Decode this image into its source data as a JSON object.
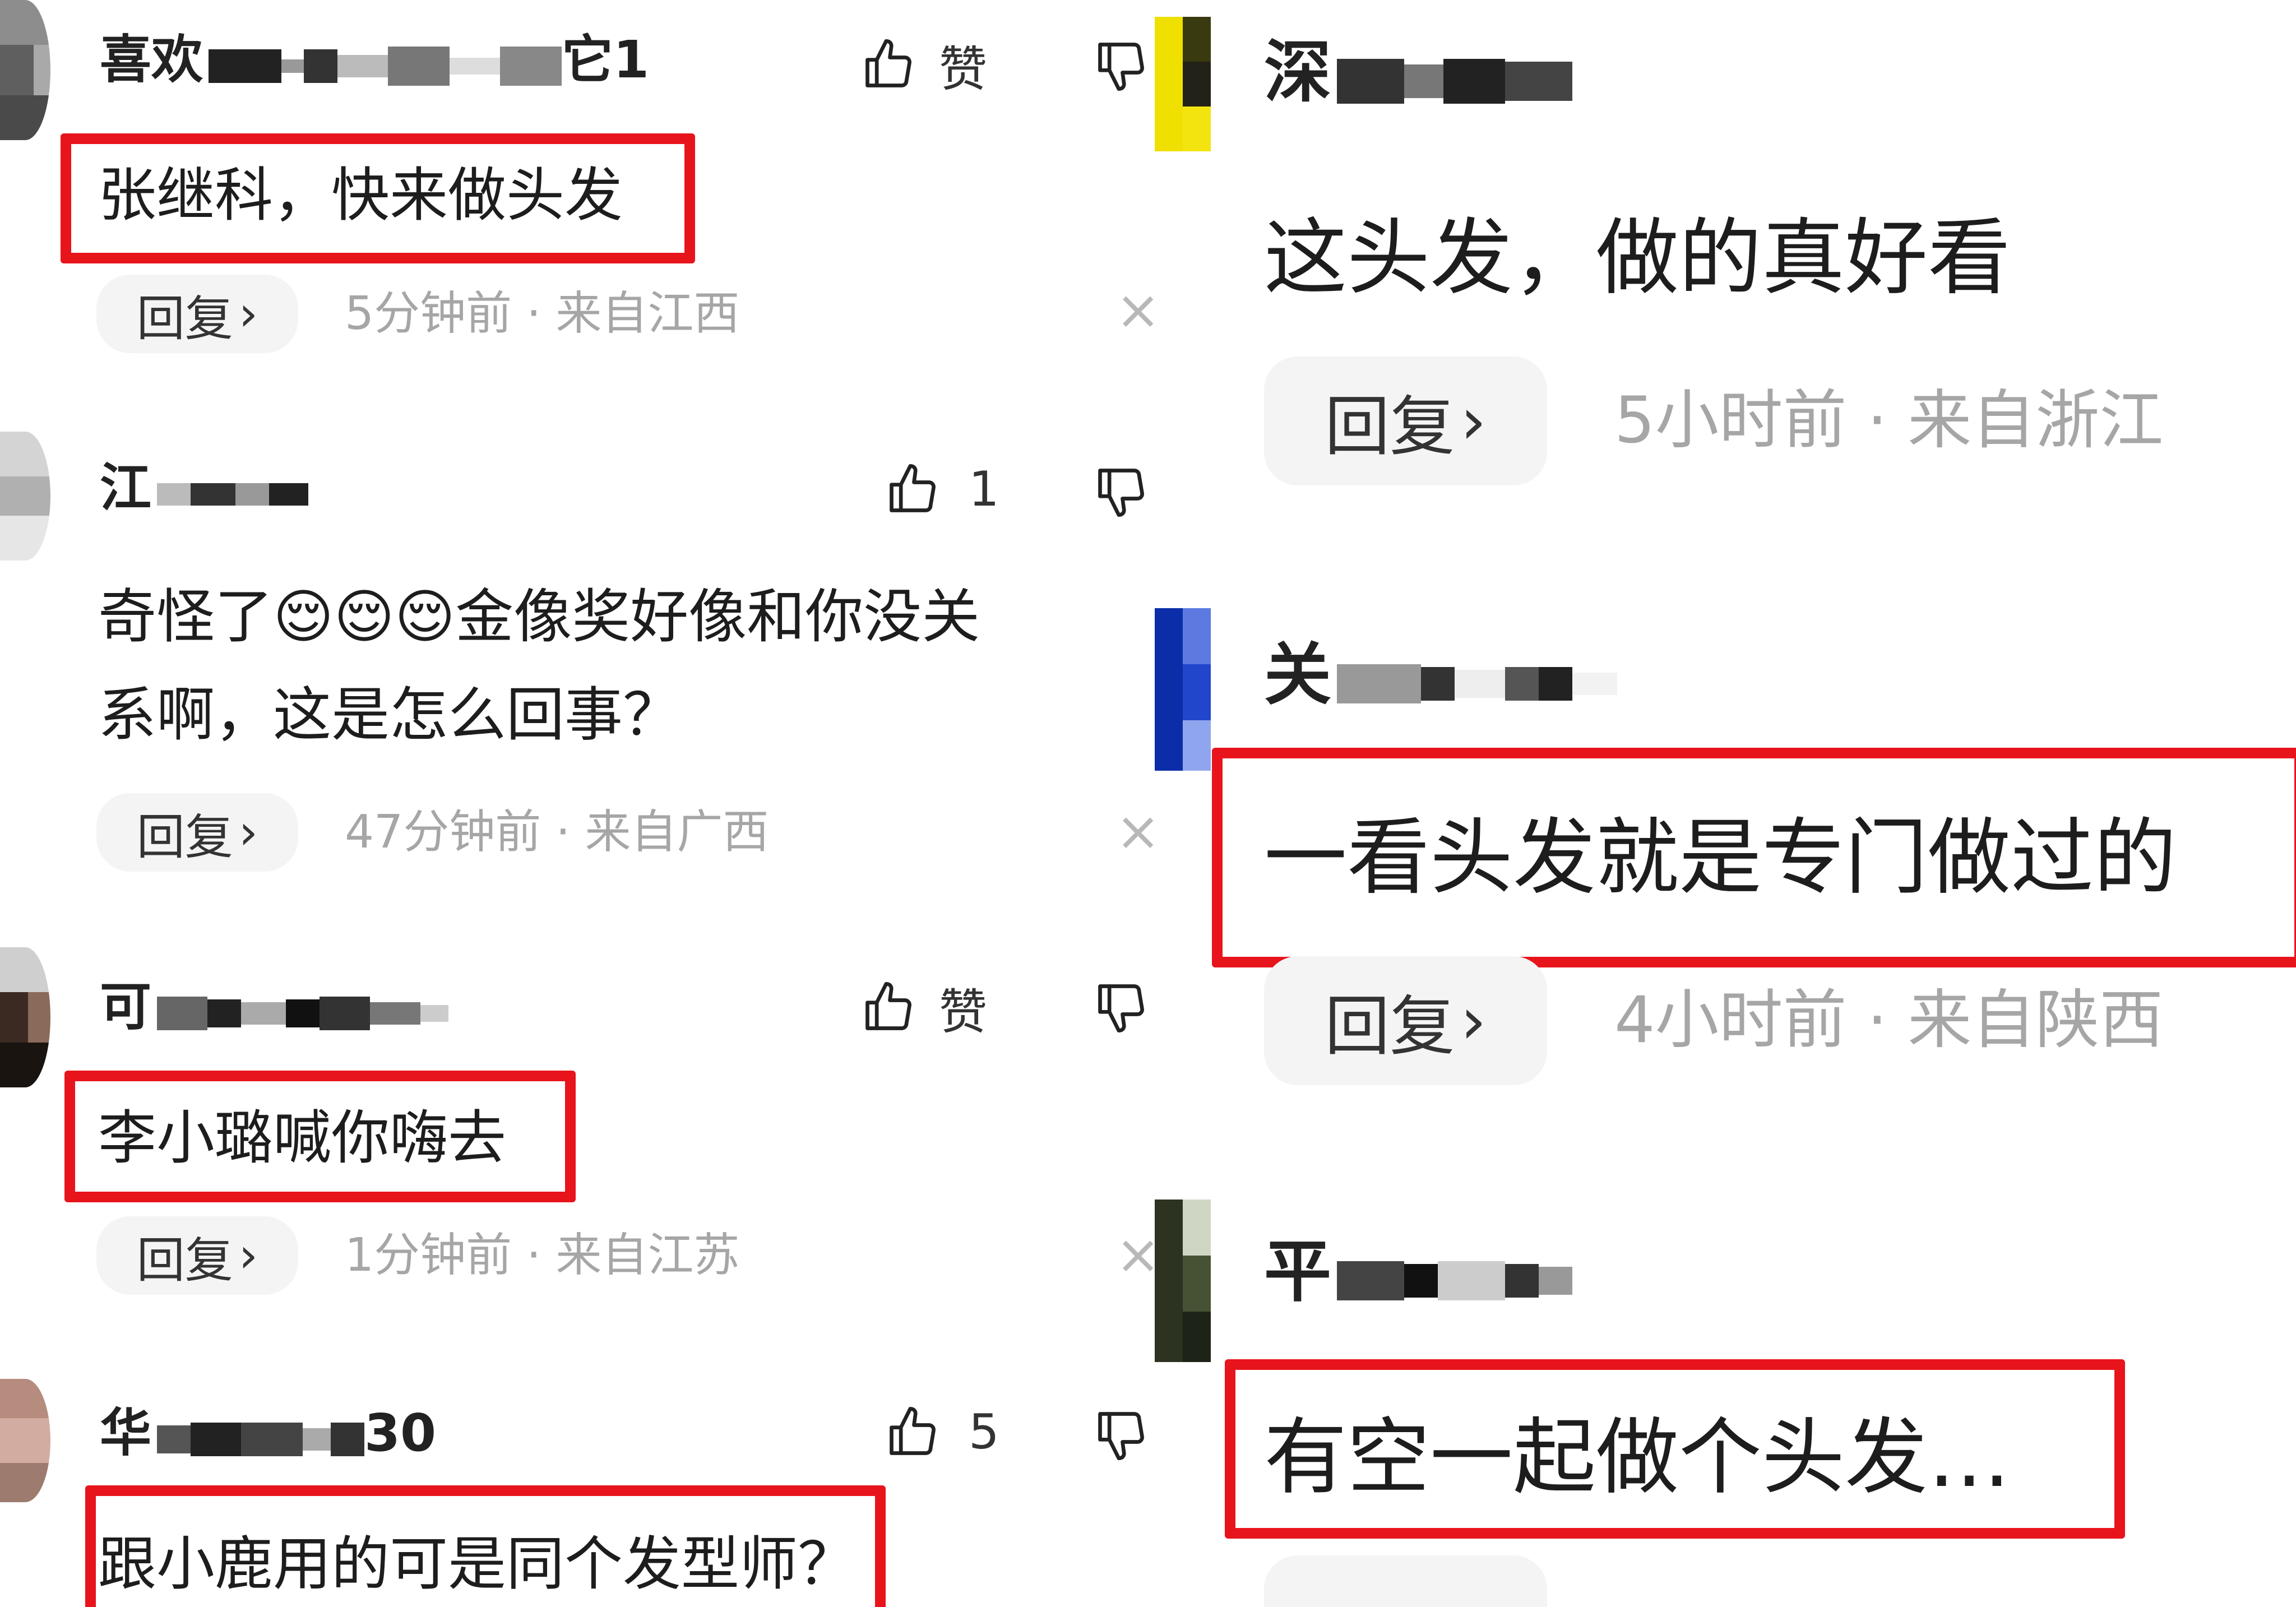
{
  "colors": {
    "highlight_border": "#e8141c",
    "meta_text": "#a6a6a6",
    "pill_bg": "#f4f4f4"
  },
  "left_panel": {
    "comments": [
      {
        "username": "喜欢",
        "username_suffix": "它1",
        "like_label": "赞",
        "text": "张继科，快来做头发",
        "highlighted": true,
        "reply_label": "回复",
        "meta": "5分钟前 · 来自江西",
        "close_glyph": "×"
      },
      {
        "username": "江",
        "username_suffix": "",
        "like_label": "1",
        "text_line1": "奇怪了",
        "emoji": [
          "😌",
          "😌",
          "😌"
        ],
        "text_line1_tail": "金像奖好像和你没关",
        "text_line2": "系啊，这是怎么回事？",
        "highlighted": false,
        "reply_label": "回复",
        "meta": "47分钟前 · 来自广西",
        "close_glyph": "×"
      },
      {
        "username": "可",
        "username_suffix": "",
        "like_label": "赞",
        "text": "李小璐喊你嗨去",
        "highlighted": true,
        "reply_label": "回复",
        "meta": "1分钟前 · 来自江苏",
        "close_glyph": "×"
      },
      {
        "username": "华",
        "username_suffix": "30",
        "like_label": "5",
        "text": "跟小鹿用的可是同个发型师？",
        "highlighted": true
      }
    ]
  },
  "right_panel": {
    "comments": [
      {
        "username": "深",
        "text": "这头发，做的真好看",
        "highlighted": false,
        "reply_label": "回复",
        "meta": "5小时前 · 来自浙江"
      },
      {
        "username": "关",
        "text": "一看头发就是专门做过的",
        "highlighted": true,
        "reply_label": "回复",
        "meta": "4小时前 · 来自陕西"
      },
      {
        "username": "平",
        "text": "有空一起做个头发…",
        "highlighted": true
      }
    ]
  }
}
